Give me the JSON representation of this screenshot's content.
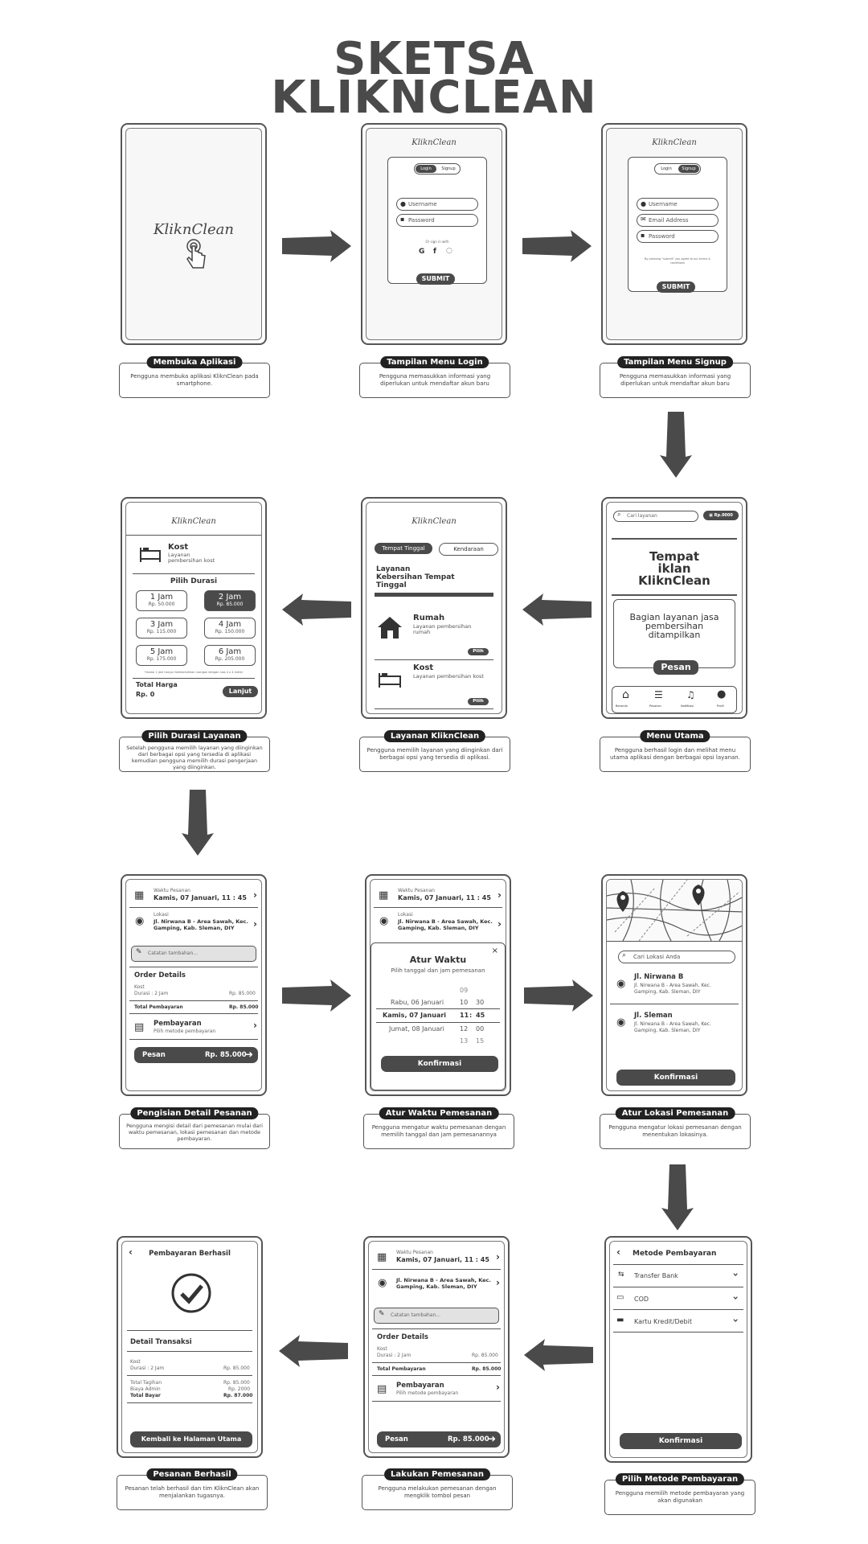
{
  "title": {
    "line1": "SKETSA",
    "line2": "KLIKNCLEAN"
  },
  "brand": "KliknClean",
  "colors": {
    "dark": "#4a4a4a",
    "outline": "#555555",
    "screen": "#f7f7f7"
  },
  "captions": [
    {
      "title": "Membuka Aplikasi",
      "desc": "Pengguna membuka aplikasi KliknClean pada smartphone."
    },
    {
      "title": "Tampilan Menu Login",
      "desc": "Pengguna memasukkan informasi yang diperlukan untuk mendaftar akun baru"
    },
    {
      "title": "Tampilan Menu Signup",
      "desc": "Pengguna memasukkan informasi yang diperlukan untuk mendaftar akun baru"
    },
    {
      "title": "Pilih Durasi Layanan",
      "desc": "Setelah pengguna memilih layanan yang diinginkan dari berbagai opsi yang tersedia di aplikasi kemudian pengguna memilih durasi pengerjaan yang diinginkan."
    },
    {
      "title": "Layanan KliknClean",
      "desc": "Pengguna memilih layanan yang diinginkan dari berbagai opsi yang tersedia di aplikasi."
    },
    {
      "title": "Menu Utama",
      "desc": "Pengguna berhasil login dan melihat menu utama aplikasi dengan berbagai opsi layanan."
    },
    {
      "title": "Pengisian Detail Pesanan",
      "desc": "Pengguna mengisi detail dari pemesanan mulai dari waktu pemesanan, lokasi pemesanan dan metode pembayaran."
    },
    {
      "title": "Atur Waktu Pemesanan",
      "desc": "Pengguna mengatur waktu pemesanan dengan memilih tanggal dan jam pemesanannya"
    },
    {
      "title": "Atur Lokasi Pemesanan",
      "desc": "Pengguna mengatur lokasi pemesanan dengan menentukan lokasinya."
    },
    {
      "title": "Pesanan Berhasil",
      "desc": "Pesanan telah berhasil dan tim KliknClean akan menjalankan tugasnya."
    },
    {
      "title": "Lakukan Pemesanan",
      "desc": "Pengguna melakukan pemesanan dengan mengklik tombol pesan"
    },
    {
      "title": "Pilih Metode Pembayaran",
      "desc": "Pengguna memilih metode pembayaran yang akan digunakan"
    }
  ],
  "login": {
    "tab_login": "Login",
    "tab_signup": "Signup",
    "username": "Username",
    "password": "Password",
    "or_sign": "Or sign in with",
    "submit": "SUBMIT"
  },
  "signup": {
    "username": "Username",
    "email": "Email Address",
    "password": "Password",
    "terms": "By pressing \"submit\" you agree to our terms & conditions",
    "submit": "SUBMIT"
  },
  "home": {
    "search": "Cari layanan",
    "balance": "Rp.0000",
    "ad_line1": "Tempat",
    "ad_line2": "iklan",
    "ad_line3": "KliknClean",
    "service_text": "Bagian layanan jasa pembersihan ditampilkan",
    "order": "Pesan",
    "nav": [
      "Beranda",
      "Pesanan",
      "Notifikasi",
      "Profil"
    ]
  },
  "services": {
    "tab1": "Tempat Tinggal",
    "tab2": "Kendaraan",
    "heading": "Layanan Kebersihan Tempat Tinggal",
    "item1_title": "Rumah",
    "item1_desc": "Layanan pembersihan rumah",
    "item2_title": "Kost",
    "item2_desc": "Layanan pembersihan kost",
    "choose": "Pilih"
  },
  "duration": {
    "title": "Kost",
    "desc": "Layanan pembersihan kost",
    "heading": "Pilih Durasi",
    "options": [
      {
        "label": "1 Jam",
        "price": "Rp. 50.000"
      },
      {
        "label": "2 Jam",
        "price": "Rp. 85.000"
      },
      {
        "label": "3 Jam",
        "price": "Rp. 115.000"
      },
      {
        "label": "4 Jam",
        "price": "Rp. 150.000"
      },
      {
        "label": "5 Jam",
        "price": "Rp. 175.000"
      },
      {
        "label": "6 Jam",
        "price": "Rp. 205.000"
      }
    ],
    "note": "*durasi 1 jam hanya membersihkan ruangan dengan luas 4 x 4 meter",
    "total_label": "Total Harga",
    "total": "Rp. 0",
    "next": "Lanjut"
  },
  "order": {
    "time_label": "Waktu Pesanan",
    "time": "Kamis, 07 Januari, 11 : 45",
    "loc_label": "Lokasi",
    "loc": "Jl. Nirwana B - Area Sawah, Kec. Gamping, Kab. Sleman, DIY",
    "note": "Catatan tambahan...",
    "details": "Order Details",
    "item": "Kost",
    "duration": "Durasi : 2 Jam",
    "price": "Rp. 85.000",
    "total_label": "Total Pembayaran",
    "total": "Rp. 85.000",
    "pay_title": "Pembayaran",
    "pay_desc": "Pilih metode pembayaran",
    "order_btn": "Pesan",
    "order_total": "Rp. 85.000"
  },
  "time": {
    "heading": "Atur Waktu",
    "sub": "Pilih tanggal dan jam pemesanan",
    "close": "×",
    "rows": [
      {
        "date": "",
        "h": "09",
        "m": ""
      },
      {
        "date": "Rabu, 06 Januari",
        "h": "10",
        "m": "30"
      },
      {
        "date": "Kamis, 07 Januari",
        "h": "11",
        "m": "45"
      },
      {
        "date": "Jumat, 08 Januari",
        "h": "12",
        "m": "00"
      },
      {
        "date": "",
        "h": "13",
        "m": "15"
      }
    ],
    "confirm": "Konfirmasi"
  },
  "location": {
    "search": "Cari Lokasi Anda",
    "loc1_title": "Jl. Nirwana B",
    "loc1_desc": "Jl. Nirwana B - Area Sawah, Kec. Gamping, Kab. Sleman, DIY",
    "loc2_title": "Jl. Sleman",
    "loc2_desc": "Jl. Nirwana B - Area Sawah, Kec. Gamping, Kab. Sleman, DIY",
    "confirm": "Konfirmasi"
  },
  "payment": {
    "title": "Metode Pembayaran",
    "methods": [
      "Transfer Bank",
      "COD",
      "Kartu Kredit/Debit"
    ],
    "confirm": "Konfirmasi"
  },
  "success": {
    "title": "Pembayaran Berhasil",
    "detail": "Detail Transaksi",
    "item": "Kost",
    "duration": "Durasi : 2 Jam",
    "price": "Rp. 85.000",
    "bill_label": "Total Tagihan",
    "bill": "Rp. 85.000",
    "admin_label": "Biaya Admin",
    "admin": "Rp. 2000",
    "paid_label": "Total Bayar",
    "paid": "Rp. 87.000",
    "home_btn": "Kembali ke Halaman Utama"
  }
}
